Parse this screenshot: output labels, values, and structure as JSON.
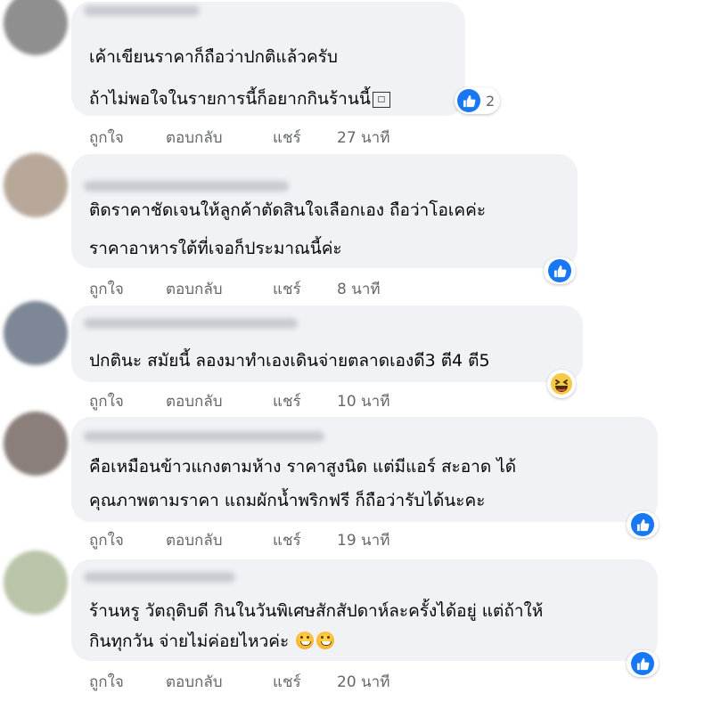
{
  "actions": {
    "like": "ถูกใจ",
    "reply": "ตอบกลับ",
    "share": "แชร์"
  },
  "comments": [
    {
      "lines": [
        "เค้าเขียนราคาก็ถือว่าปกติแล้วครับ",
        "ถ้าไม่พอใจในรายการนี้ก็อยากกินร้านนี้"
      ],
      "time": "27 นาที",
      "likes": "2",
      "reaction": "like",
      "avatar_color": "#8f8f8f"
    },
    {
      "lines": [
        "ติดราคาชัดเจนให้ลูกค้าตัดสินใจเลือกเอง ถือว่าโอเคค่ะ",
        "ราคาอาหารใต้ที่เจอก็ประมาณนี้ค่ะ"
      ],
      "time": "8 นาที",
      "likes": "",
      "reaction": "like",
      "avatar_color": "#b7a89a"
    },
    {
      "lines": [
        "ปกตินะ สมัยนี้ ลองมาทำเองเดินจ่ายตลาดเองดี3 ตี4 ตี5"
      ],
      "time": "10 นาที",
      "likes": "",
      "reaction": "haha",
      "avatar_color": "#7d8795"
    },
    {
      "lines": [
        "คือเหมือนข้าวแกงตามห้าง ราคาสูงนิด แต่มีแอร์ สะอาด ได้",
        "คุณภาพตามราคา แถมผักน้ำพริกฟรี ก็ถือว่ารับได้นะคะ"
      ],
      "time": "19 นาที",
      "likes": "",
      "reaction": "like",
      "avatar_color": "#8a7f7a"
    },
    {
      "lines": [
        "ร้านหรู วัตถุดิบดี กินในวันพิเศษสักสัปดาห์ละครั้งได้อยู่ แต่ถ้าให้",
        "กินทุกวัน จ่ายไม่ค่อยไหวค่ะ"
      ],
      "time": "20 นาที",
      "likes": "",
      "reaction": "like",
      "avatar_color": "#b9c4a8"
    }
  ],
  "colors": {
    "bubble": "#f0f2f5",
    "meta_text": "#65676b",
    "like_blue": "#1877f2",
    "text": "#050505"
  },
  "icons": {
    "like": "thumbs-up-icon",
    "haha": "laughing-face-icon",
    "emoji": "grinning-sweat-emoji"
  }
}
